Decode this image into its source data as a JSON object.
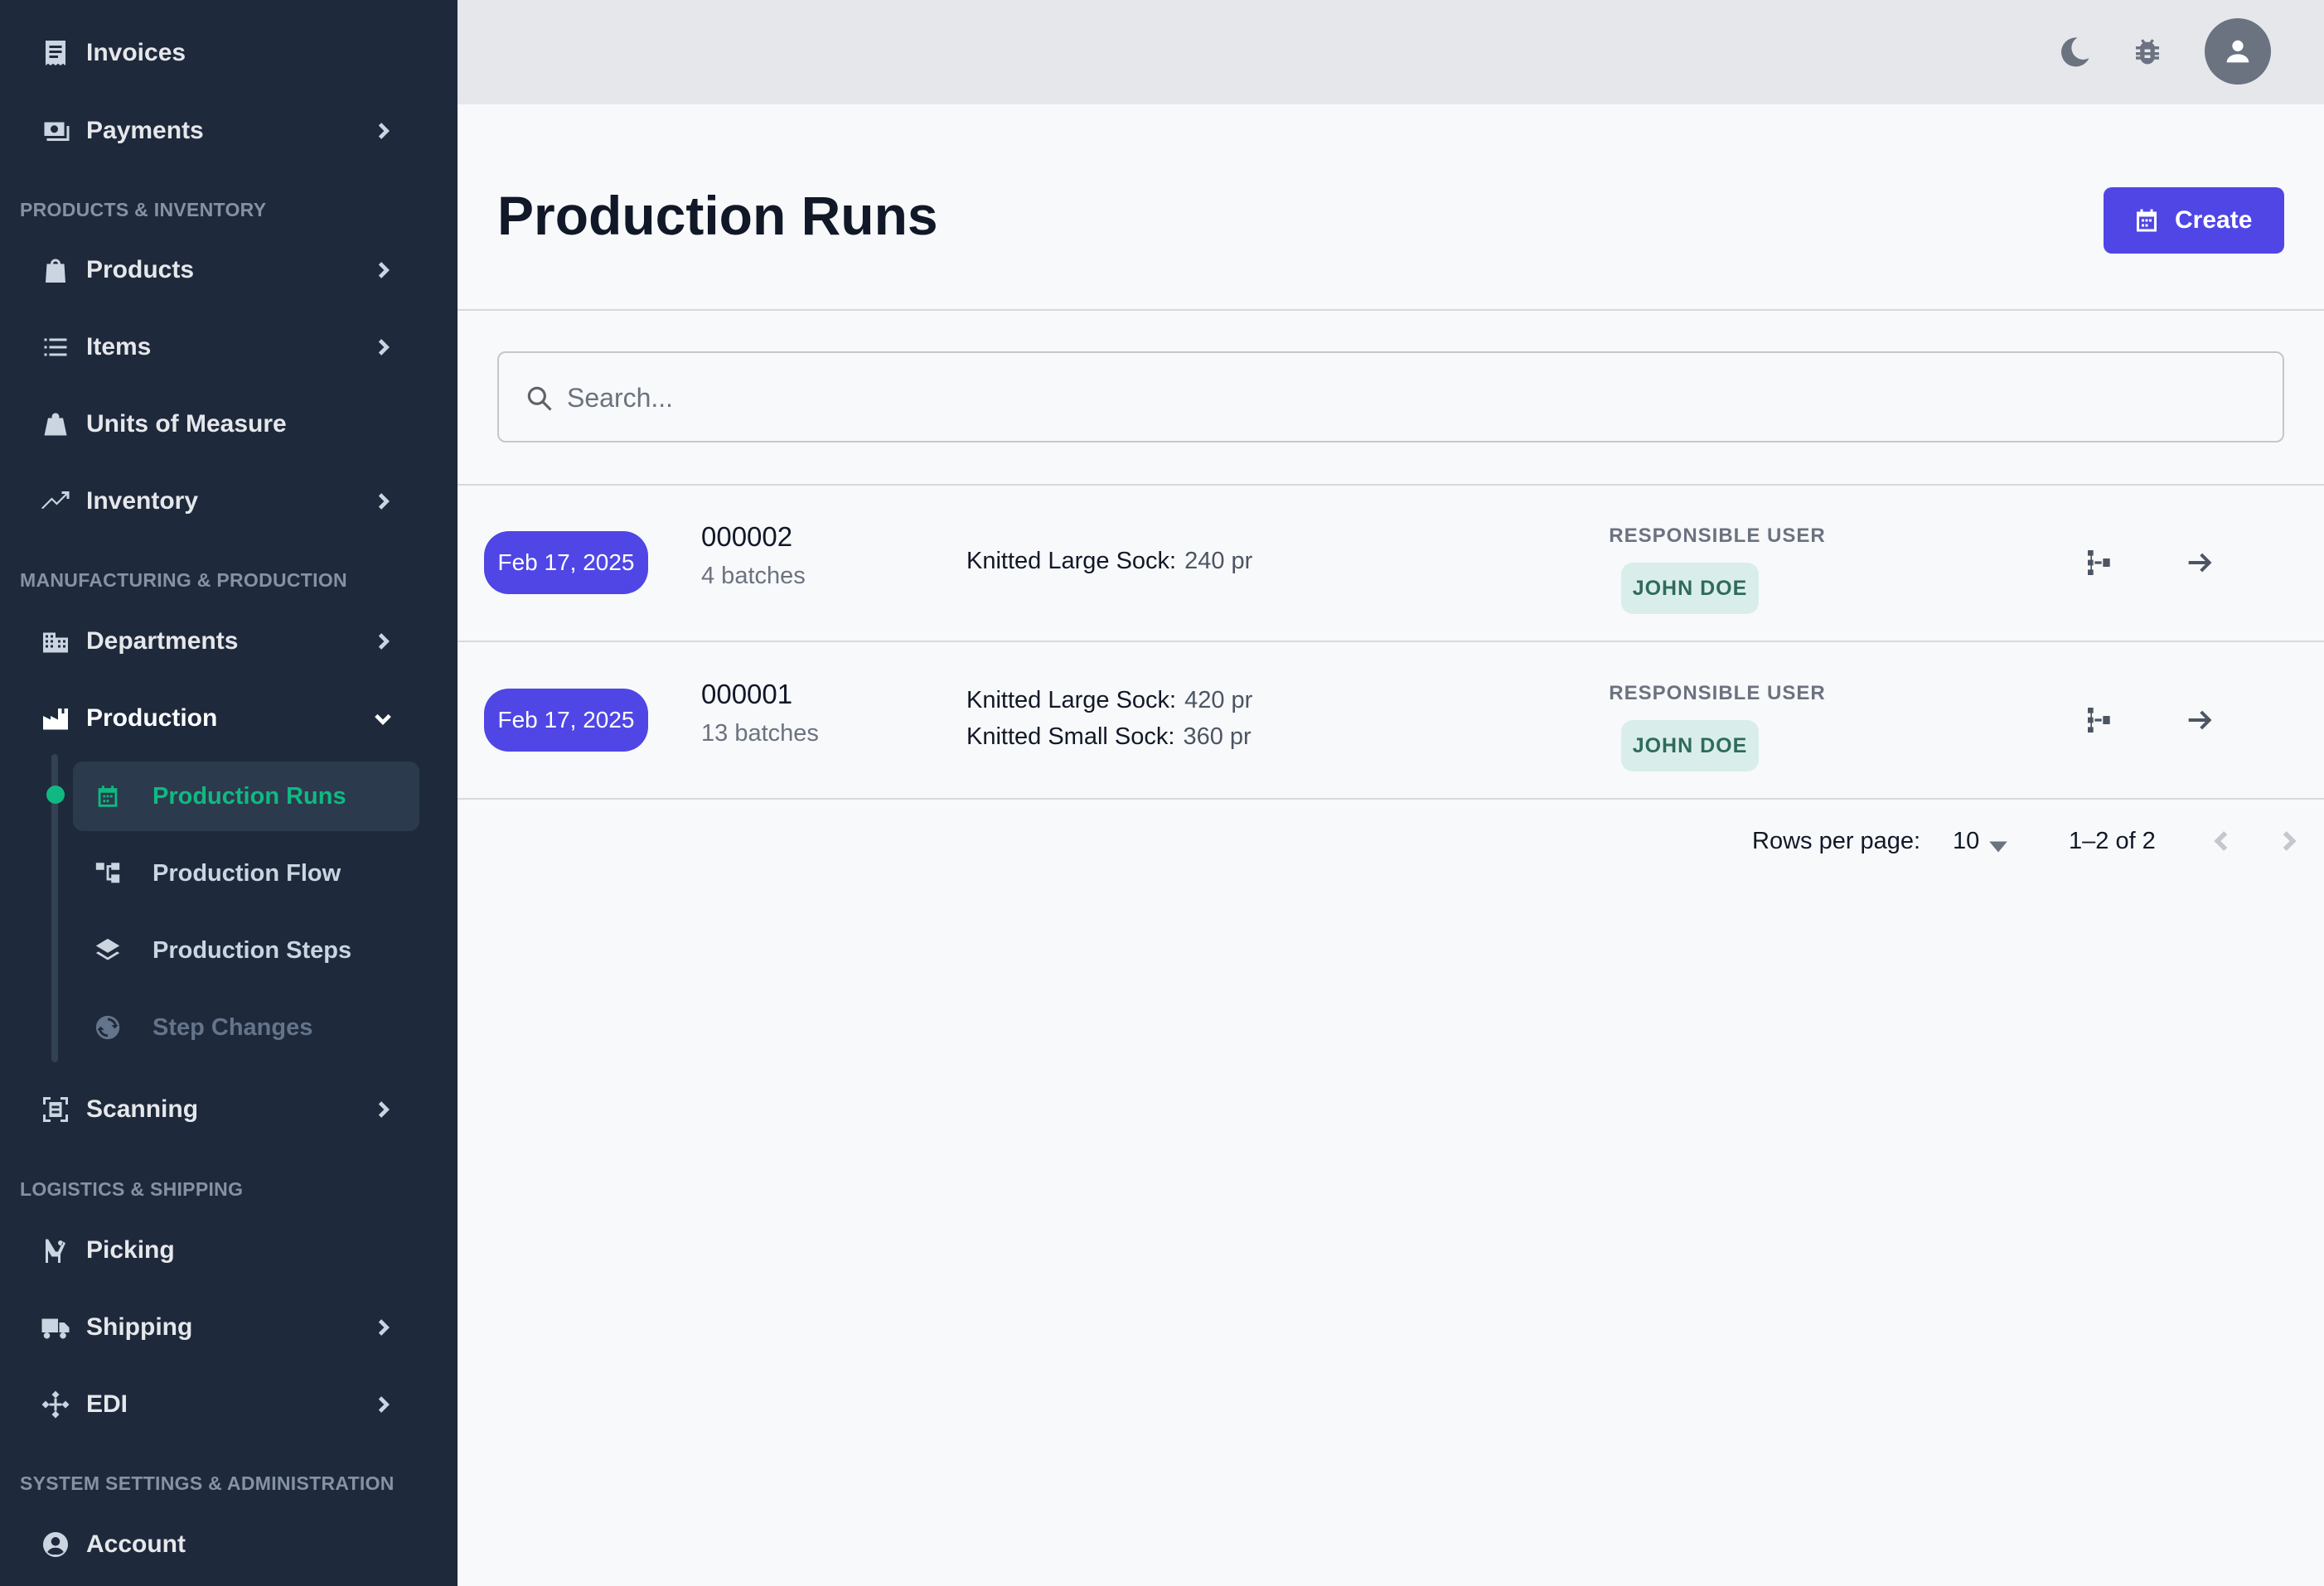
{
  "sidebar": {
    "items": [
      {
        "label": "Invoices",
        "icon": "receipt-icon"
      },
      {
        "label": "Payments",
        "icon": "cash-icon"
      },
      {
        "label": "Products",
        "icon": "shopping-bag-icon"
      },
      {
        "label": "Items",
        "icon": "list-icon"
      },
      {
        "label": "Units of Measure",
        "icon": "weight-icon"
      },
      {
        "label": "Inventory",
        "icon": "trending-up-icon"
      },
      {
        "label": "Departments",
        "icon": "building-icon"
      },
      {
        "label": "Production",
        "icon": "factory-icon"
      },
      {
        "label": "Scanning",
        "icon": "scan-icon"
      },
      {
        "label": "Picking",
        "icon": "forklift-icon"
      },
      {
        "label": "Shipping",
        "icon": "truck-icon"
      },
      {
        "label": "EDI",
        "icon": "network-icon"
      },
      {
        "label": "Account",
        "icon": "account-circle-icon"
      }
    ],
    "sections": [
      "PRODUCTS & INVENTORY",
      "MANUFACTURING & PRODUCTION",
      "LOGISTICS & SHIPPING",
      "SYSTEM SETTINGS & ADMINISTRATION"
    ],
    "production_sub": [
      {
        "label": "Production Runs",
        "icon": "calendar-icon",
        "active": true
      },
      {
        "label": "Production Flow",
        "icon": "flow-icon"
      },
      {
        "label": "Production Steps",
        "icon": "layers-icon"
      },
      {
        "label": "Step Changes",
        "icon": "sync-icon"
      }
    ]
  },
  "topbar": {
    "icons": [
      "moon-icon",
      "bug-icon",
      "user-avatar-icon"
    ]
  },
  "main": {
    "title": "Production Runs",
    "create_label": "Create",
    "search_placeholder": "Search...",
    "runs": [
      {
        "date": "Feb 17, 2025",
        "id": "000002",
        "batches": "4 batches",
        "products": [
          {
            "name": "Knitted Large Sock:",
            "qty": "240 pr"
          }
        ],
        "responsible_label": "RESPONSIBLE USER",
        "user": "JOHN DOE"
      },
      {
        "date": "Feb 17, 2025",
        "id": "000001",
        "batches": "13 batches",
        "products": [
          {
            "name": "Knitted Large Sock:",
            "qty": "420 pr"
          },
          {
            "name": "Knitted Small Sock:",
            "qty": "360 pr"
          }
        ],
        "responsible_label": "RESPONSIBLE USER",
        "user": "JOHN DOE"
      }
    ],
    "pagination": {
      "rows_label": "Rows per page:",
      "rows_value": "10",
      "range": "1–2 of 2"
    }
  },
  "colors": {
    "sidebar_bg": "#1e293b",
    "accent": "#4f46e5",
    "active_green": "#10b981",
    "chip_bg": "#d9eeea"
  }
}
